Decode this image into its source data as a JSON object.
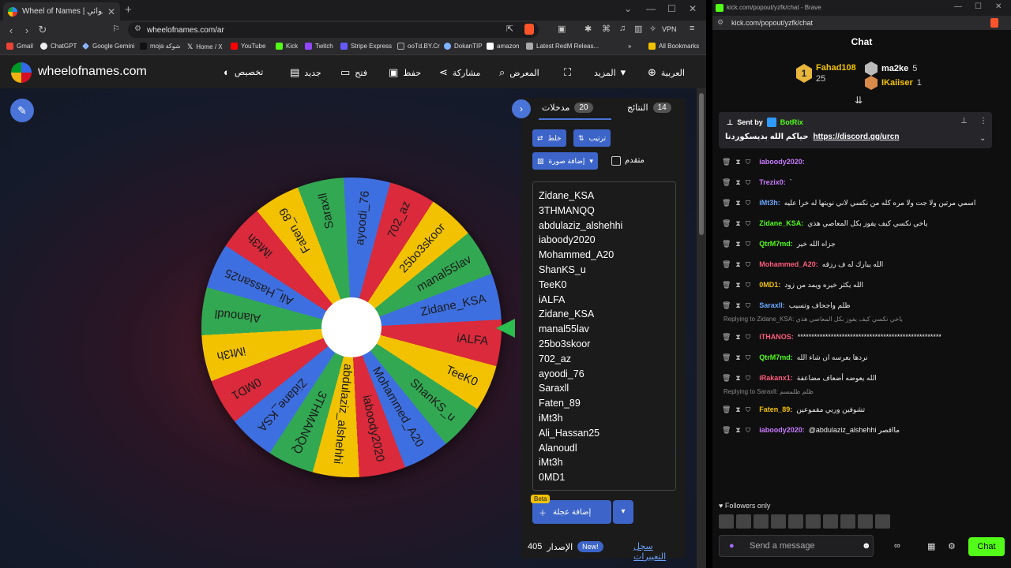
{
  "browser": {
    "tab_title": "Wheel of Names | عجلة الاسم العشوائي",
    "url": "wheelofnames.com/ar",
    "vpn_label": "VPN",
    "bookmarks": [
      "Gmail",
      "ChatGPT",
      "Google Gemini",
      "moja شوكة",
      "Home / X",
      "YouTube",
      "Kick",
      "Twitch",
      "Stripe Express",
      "ooTd.BY.Cr",
      "DokanTIP",
      "amazon",
      "Latest RedM Releas..."
    ],
    "all_bookmarks": "All Bookmarks"
  },
  "site": {
    "logo_text": "wheelofnames.com",
    "nav": [
      "تخصيص",
      "جديد",
      "فتح",
      "حفظ",
      "مشاركة",
      "المعرض",
      "المزيد",
      "العربية"
    ]
  },
  "wheel": {
    "segments": [
      {
        "label": "iALFA",
        "color": "#32a852"
      },
      {
        "label": "TeeK0",
        "color": "#f2c200"
      },
      {
        "label": "ShanKS_u",
        "color": "#da2a3b"
      },
      {
        "label": "Mohammed_A20",
        "color": "#3e6fe0"
      },
      {
        "label": "iaboody2020",
        "color": "#32a852"
      },
      {
        "label": "abdulaziz_alshehhi",
        "color": "#f2c200"
      },
      {
        "label": "3THMANQQ",
        "color": "#da2a3b"
      },
      {
        "label": "Zidane_KSA",
        "color": "#3e6fe0"
      },
      {
        "label": "0MD1",
        "color": "#32a852"
      },
      {
        "label": "iMt3h",
        "color": "#f2c200"
      },
      {
        "label": "Alanoudl",
        "color": "#da2a3b"
      },
      {
        "label": "Ali_Hassan25",
        "color": "#3e6fe0"
      },
      {
        "label": "iMt3h",
        "color": "#32a852"
      },
      {
        "label": "Faten_89",
        "color": "#f2c200"
      },
      {
        "label": "Saraxll",
        "color": "#da2a3b"
      },
      {
        "label": "ayoodi_76",
        "color": "#3e6fe0"
      },
      {
        "label": "702_az",
        "color": "#32a852"
      },
      {
        "label": "25bo3skoor",
        "color": "#f2c200"
      },
      {
        "label": "manal55lav",
        "color": "#da2a3b"
      },
      {
        "label": "Zidane_KSA",
        "color": "#3e6fe0"
      }
    ]
  },
  "panel": {
    "tab_entries": "مدخلات",
    "entries_count": "20",
    "tab_results": "النتائج",
    "results_count": "14",
    "shuffle": "خلط",
    "sort": "ترتيب",
    "add_image": "إضافة صورة",
    "advanced": "متقدم",
    "entries": [
      "Zidane_KSA",
      "3THMANQQ",
      "abdulaziz_alshehhi",
      "iaboody2020",
      "Mohammed_A20",
      "ShanKS_u",
      "TeeK0",
      "iALFA",
      "Zidane_KSA",
      "manal55lav",
      "25bo3skoor",
      "702_az",
      "ayoodi_76",
      "Saraxll",
      "Faten_89",
      "iMt3h",
      "Ali_Hassan25",
      "Alanoudl",
      "iMt3h",
      "0MD1"
    ],
    "beta": "Beta",
    "add_wheel": "إضافة عجلة",
    "version_label": "الإصدار",
    "version_number": "405",
    "new_badge": "New!",
    "changelog": "سجل التغييرات"
  },
  "chat": {
    "window_title": "kick.com/popout/yzfk/chat - Brave",
    "url": "kick.com/popout/yzfk/chat",
    "title": "Chat",
    "leaders": [
      {
        "rank": "1",
        "name": "Fahad108",
        "value": "25"
      },
      {
        "rank": "",
        "name": "ma2ke",
        "value": "5"
      },
      {
        "rank": "",
        "name": "IKaiiser",
        "value": "1"
      }
    ],
    "pinned": {
      "sent_by": "Sent by",
      "sender": "BotRix",
      "text": "حياكم الله بديسكوردنا",
      "link": "https://discord.gg/urcn"
    },
    "messages": [
      {
        "user": "iaboody2020:",
        "text": "",
        "color": "#c97bff"
      },
      {
        "user": "Trezix0:",
        "text": "`",
        "color": "#c97bff"
      },
      {
        "user": "iMt3h:",
        "text": "اسمي مرتين ولا جت ولا مره كله من نكسي لاني نويتها له خرا عليه",
        "color": "#6aa8ff"
      },
      {
        "user": "Zidane_KSA:",
        "text": "ياخي نكسي كيف يفوز بكل المعاصي هذي",
        "color": "#53fc18"
      },
      {
        "user": "QtrM7md:",
        "text": "جزاه الله خير",
        "color": "#53fc18"
      },
      {
        "user": "Mohammed_A20:",
        "text": "الله يبارك له ف رزقه",
        "color": "#ff5c7a"
      },
      {
        "user": "0MD1:",
        "text": "الله يكثر خيره ويمد من زود",
        "color": "#f2c200"
      },
      {
        "user": "Saraxll:",
        "text": "ظلم واجحاف وتسيب",
        "color": "#6aa8ff"
      },
      {
        "reply": "Replying to Zidane_KSA: ياخي نكسي كيف يفوز بكل المعاصي هذي"
      },
      {
        "user": "iTHANOS:",
        "text": "****************************************************",
        "color": "#ff5c7a"
      },
      {
        "user": "QtrM7md:",
        "text": "نردها بعرسه ان شاء الله",
        "color": "#53fc18"
      },
      {
        "user": "iRakanx1:",
        "text": "الله يعوضه أضعاف مضاعفة",
        "color": "#ff5c7a"
      },
      {
        "reply": "Replying to Saraxll: ظلم ظلمسم"
      },
      {
        "user": "Faten_89:",
        "text": "تشوفين وربي مقموعين",
        "color": "#f2c200"
      },
      {
        "user": "iaboody2020:",
        "text": "@abdulaziz_alshehhi مااقصر",
        "color": "#c97bff"
      }
    ],
    "followers_only": "Followers only",
    "input_placeholder": "Send a message",
    "send_button": "Chat"
  }
}
